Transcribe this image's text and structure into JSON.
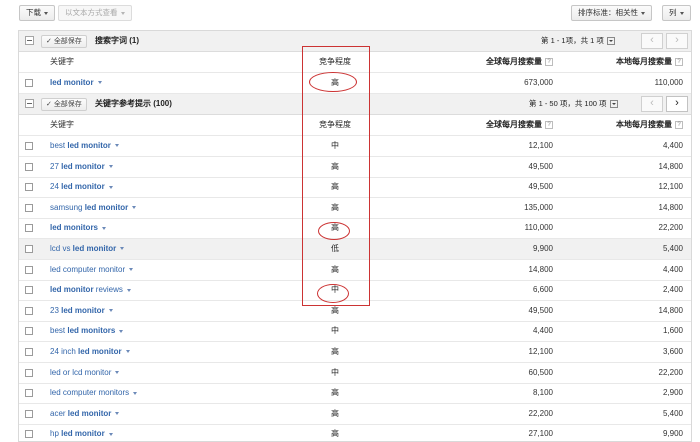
{
  "toolbar": {
    "download_label": "下载",
    "view_as_text_label": "以文本方式查看",
    "sort_label": "排序标准：相关性",
    "columns_label": "列"
  },
  "search_section": {
    "save_all_label": "全部保存",
    "title": "搜索字词 (1)",
    "pagination": "第 1 - 1项，共 1 项"
  },
  "headers": {
    "keyword": "关键字",
    "competition": "竞争程度",
    "global_monthly": "全球每月搜索量",
    "local_monthly": "本地每月搜索量"
  },
  "search_terms": [
    {
      "pre": "",
      "bold": "led monitor",
      "post": "",
      "competition": "高",
      "global": "673,000",
      "local": "110,000"
    }
  ],
  "ideas_section": {
    "save_all_label": "全部保存",
    "title": "关键字参考提示 (100)",
    "pagination": "第 1 - 50 项，共 100 项"
  },
  "ideas": [
    {
      "pre": "best ",
      "bold": "led monitor",
      "post": "",
      "competition": "中",
      "global": "12,100",
      "local": "4,400"
    },
    {
      "pre": "27 ",
      "bold": "led monitor",
      "post": "",
      "competition": "高",
      "global": "49,500",
      "local": "14,800"
    },
    {
      "pre": "24 ",
      "bold": "led monitor",
      "post": "",
      "competition": "高",
      "global": "49,500",
      "local": "12,100"
    },
    {
      "pre": "samsung ",
      "bold": "led monitor",
      "post": "",
      "competition": "高",
      "global": "135,000",
      "local": "14,800"
    },
    {
      "pre": "",
      "bold": "led monitors",
      "post": "",
      "competition": "高",
      "global": "110,000",
      "local": "22,200"
    },
    {
      "pre": "lcd vs ",
      "bold": "led monitor",
      "post": "",
      "competition": "低",
      "global": "9,900",
      "local": "5,400"
    },
    {
      "pre": "led computer monitor",
      "bold": "",
      "post": "",
      "competition": "高",
      "global": "14,800",
      "local": "4,400"
    },
    {
      "pre": "",
      "bold": "led monitor",
      "post": " reviews",
      "competition": "中",
      "global": "6,600",
      "local": "2,400"
    },
    {
      "pre": "23 ",
      "bold": "led monitor",
      "post": "",
      "competition": "高",
      "global": "49,500",
      "local": "14,800"
    },
    {
      "pre": "best ",
      "bold": "led monitors",
      "post": "",
      "competition": "中",
      "global": "4,400",
      "local": "1,600"
    },
    {
      "pre": "24 inch ",
      "bold": "led monitor",
      "post": "",
      "competition": "高",
      "global": "12,100",
      "local": "3,600"
    },
    {
      "pre": "led or lcd monitor",
      "bold": "",
      "post": "",
      "competition": "中",
      "global": "60,500",
      "local": "22,200"
    },
    {
      "pre": "led computer monitors",
      "bold": "",
      "post": "",
      "competition": "高",
      "global": "8,100",
      "local": "2,900"
    },
    {
      "pre": "acer ",
      "bold": "led monitor",
      "post": "",
      "competition": "高",
      "global": "22,200",
      "local": "5,400"
    },
    {
      "pre": "hp ",
      "bold": "led monitor",
      "post": "",
      "competition": "高",
      "global": "27,100",
      "local": "9,900"
    }
  ],
  "accent_colors": {
    "link": "#3366aa",
    "annotation": "#cc3333"
  }
}
